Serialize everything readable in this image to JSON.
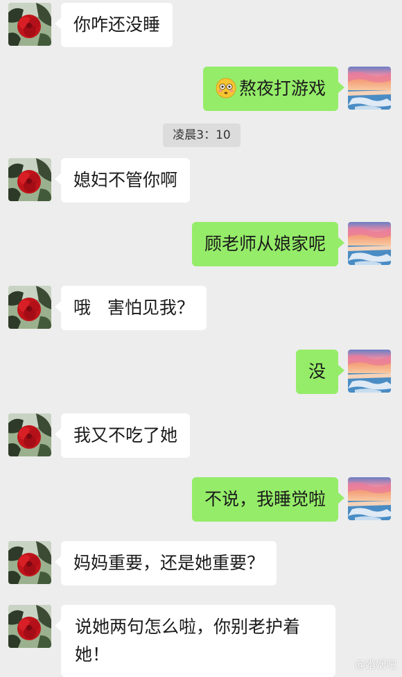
{
  "messages": [
    {
      "side": "in",
      "text": "你咋还没睡"
    },
    {
      "side": "out",
      "emoji": "flushed-face-emoji",
      "text": "熬夜打游戏"
    },
    {
      "side": "in",
      "text": "媳妇不管你啊"
    },
    {
      "side": "out",
      "text": "顾老师从娘家呢"
    },
    {
      "side": "in",
      "text": "哦   害怕见我？"
    },
    {
      "side": "out",
      "text": "没"
    },
    {
      "side": "in",
      "text": "我又不吃了她"
    },
    {
      "side": "out",
      "text": "不说，我睡觉啦"
    },
    {
      "side": "in",
      "text": "妈妈重要，还是她重要？"
    },
    {
      "side": "in",
      "text": "说她两句怎么啦，你别老护着她！"
    }
  ],
  "timestamp": "凌晨3：10",
  "watermark": "@婚姻吧",
  "colors": {
    "background": "#ededed",
    "incoming_bubble": "#ffffff",
    "outgoing_bubble": "#95ec69"
  },
  "avatars": {
    "incoming": "red-flower-avatar",
    "outgoing": "sunset-sea-avatar"
  }
}
